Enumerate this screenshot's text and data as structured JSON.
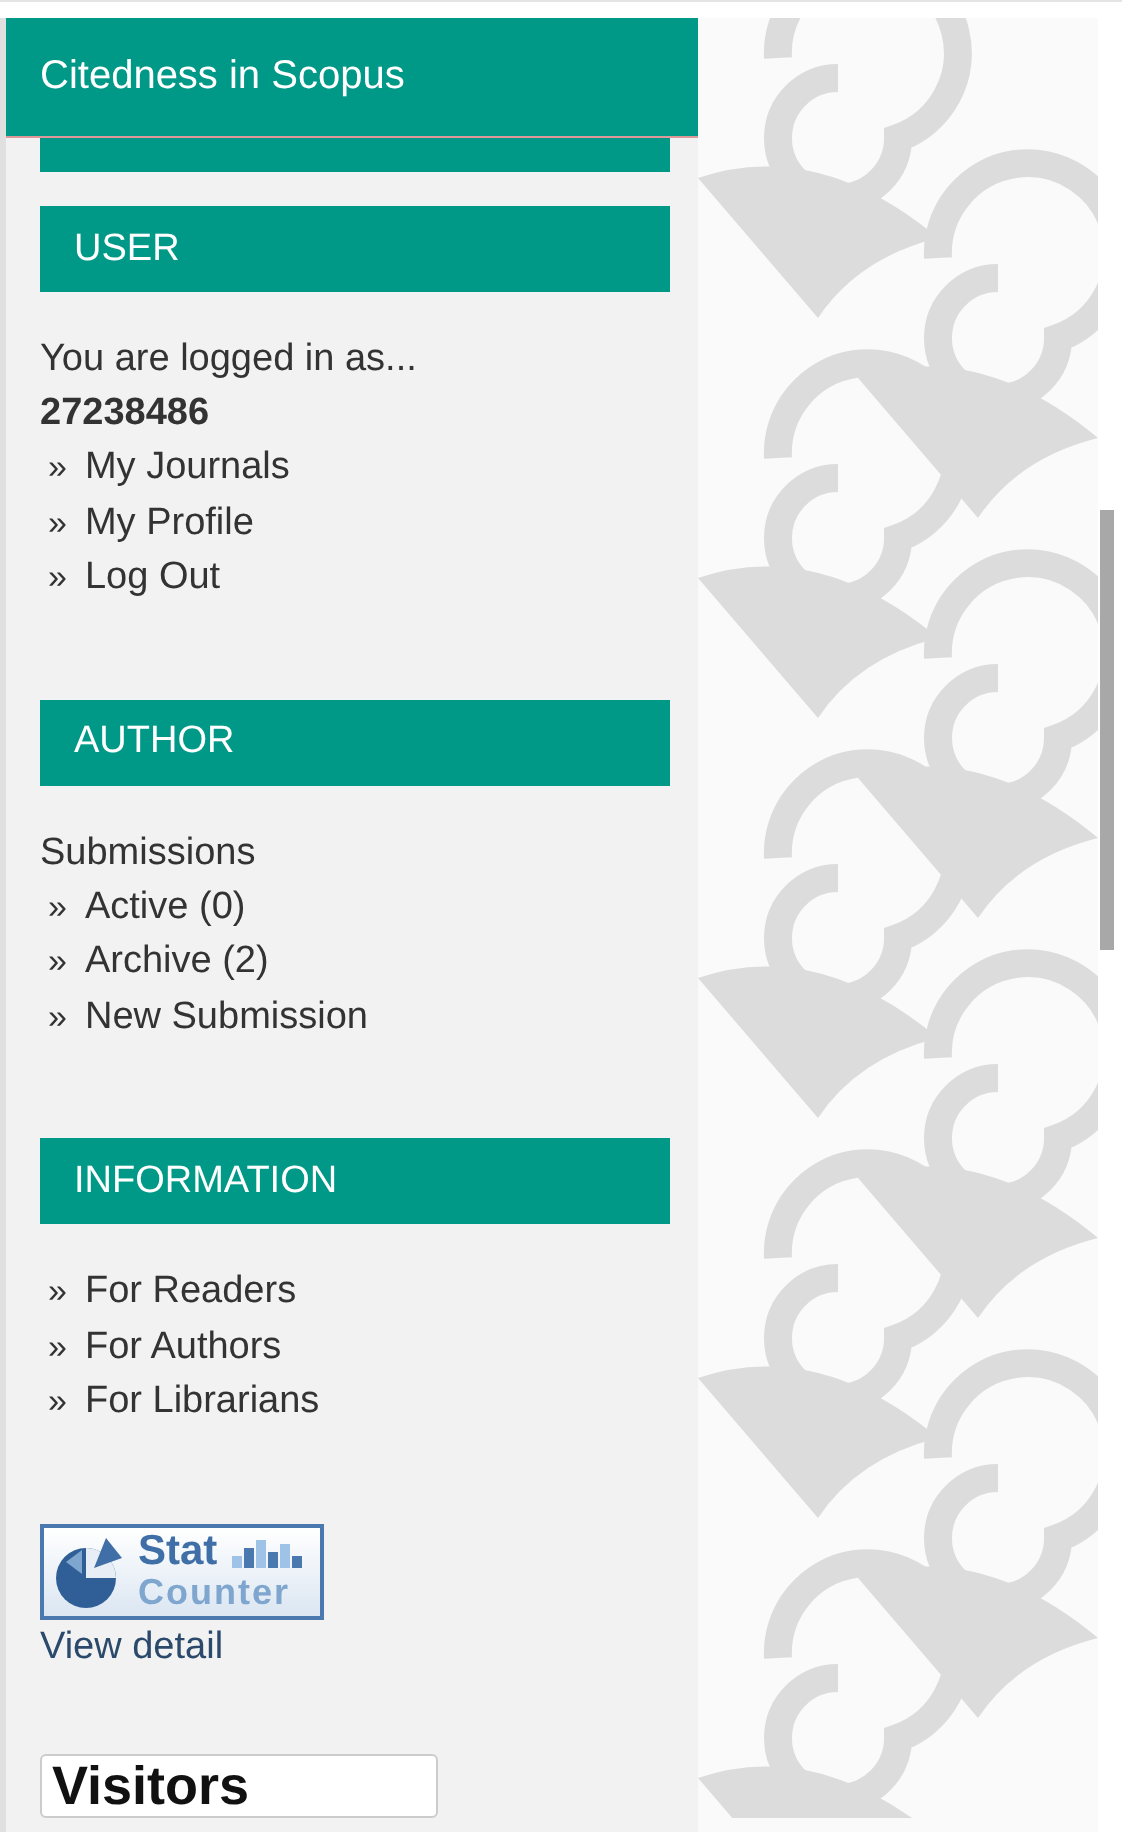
{
  "header": {
    "title": "Citedness in Scopus"
  },
  "sections": [
    {
      "title": "USER",
      "intro": "You are logged in as...",
      "username": "27238486",
      "links": [
        "My Journals",
        "My Profile",
        "Log Out"
      ]
    },
    {
      "title": "AUTHOR",
      "intro": "Submissions",
      "links": [
        "Active (0)",
        "Archive (2)",
        "New Submission"
      ]
    },
    {
      "title": "INFORMATION",
      "links": [
        "For Readers",
        "For Authors",
        "For Librarians"
      ]
    }
  ],
  "stat_counter": {
    "logo_top": "Stat",
    "logo_bottom": "Counter",
    "link": "View detail"
  },
  "visitors": {
    "title": "Visitors"
  },
  "bullet": "»"
}
